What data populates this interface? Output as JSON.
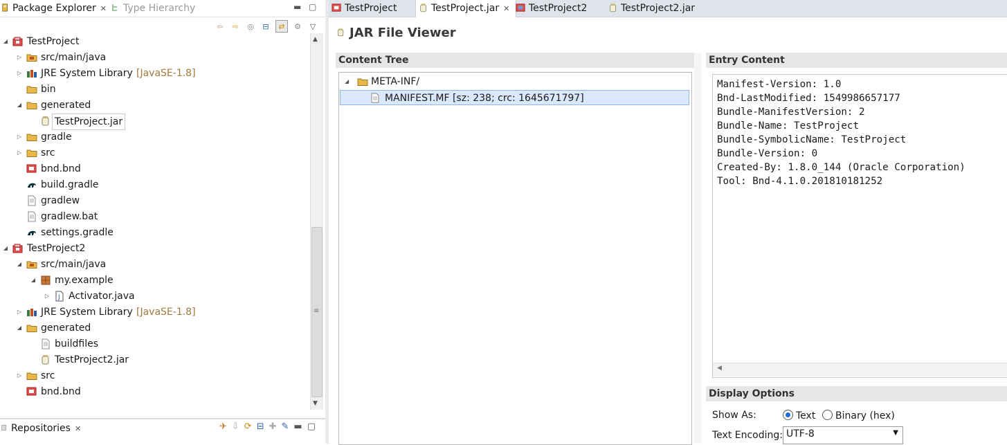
{
  "explorer": {
    "tab_label": "Package Explorer",
    "tab2_label": "Type Hierarchy",
    "tree": [
      {
        "label": "TestProject",
        "deco": "",
        "indent": 0,
        "twisty": "▲",
        "icon": "project-icon"
      },
      {
        "label": "src/main/java",
        "deco": "",
        "indent": 1,
        "twisty": "▷",
        "icon": "source-folder-icon"
      },
      {
        "label": "JRE System Library",
        "deco": "[JavaSE-1.8]",
        "indent": 1,
        "twisty": "▷",
        "icon": "library-icon"
      },
      {
        "label": "bin",
        "deco": "",
        "indent": 1,
        "twisty": "",
        "icon": "folder-icon"
      },
      {
        "label": "generated",
        "deco": "",
        "indent": 1,
        "twisty": "▲",
        "icon": "folder-icon"
      },
      {
        "label": "TestProject.jar",
        "deco": "",
        "indent": 2,
        "twisty": "",
        "icon": "jar-icon",
        "selected": true
      },
      {
        "label": "gradle",
        "deco": "",
        "indent": 1,
        "twisty": "▷",
        "icon": "folder-icon"
      },
      {
        "label": "src",
        "deco": "",
        "indent": 1,
        "twisty": "▷",
        "icon": "folder-icon"
      },
      {
        "label": "bnd.bnd",
        "deco": "",
        "indent": 1,
        "twisty": "",
        "icon": "bnd-file-icon"
      },
      {
        "label": "build.gradle",
        "deco": "",
        "indent": 1,
        "twisty": "",
        "icon": "gradle-icon"
      },
      {
        "label": "gradlew",
        "deco": "",
        "indent": 1,
        "twisty": "",
        "icon": "file-icon"
      },
      {
        "label": "gradlew.bat",
        "deco": "",
        "indent": 1,
        "twisty": "",
        "icon": "file-icon"
      },
      {
        "label": "settings.gradle",
        "deco": "",
        "indent": 1,
        "twisty": "",
        "icon": "gradle-icon"
      },
      {
        "label": "TestProject2",
        "deco": "",
        "indent": 0,
        "twisty": "▲",
        "icon": "project-icon"
      },
      {
        "label": "src/main/java",
        "deco": "",
        "indent": 1,
        "twisty": "▲",
        "icon": "source-folder-icon"
      },
      {
        "label": "my.example",
        "deco": "",
        "indent": 2,
        "twisty": "▲",
        "icon": "package-icon"
      },
      {
        "label": "Activator.java",
        "deco": "",
        "indent": 3,
        "twisty": "▷",
        "icon": "java-file-icon"
      },
      {
        "label": "JRE System Library",
        "deco": "[JavaSE-1.8]",
        "indent": 1,
        "twisty": "▷",
        "icon": "library-icon"
      },
      {
        "label": "generated",
        "deco": "",
        "indent": 1,
        "twisty": "▲",
        "icon": "folder-icon"
      },
      {
        "label": "buildfiles",
        "deco": "",
        "indent": 2,
        "twisty": "",
        "icon": "file-icon"
      },
      {
        "label": "TestProject2.jar",
        "deco": "",
        "indent": 2,
        "twisty": "",
        "icon": "jar-icon"
      },
      {
        "label": "src",
        "deco": "",
        "indent": 1,
        "twisty": "▷",
        "icon": "folder-icon"
      },
      {
        "label": "bnd.bnd",
        "deco": "",
        "indent": 1,
        "twisty": "",
        "icon": "bnd-file-icon"
      }
    ]
  },
  "repositories": {
    "tab_label": "Repositories"
  },
  "editor": {
    "tabs": [
      {
        "label": "TestProject",
        "icon": "bnd-file-icon"
      },
      {
        "label": "TestProject.jar",
        "icon": "jar-icon",
        "active": true
      },
      {
        "label": "TestProject2",
        "icon": "bnd-file-icon"
      },
      {
        "label": "TestProject2.jar",
        "icon": "jar-icon"
      }
    ],
    "viewer_title": "JAR File Viewer",
    "content_tree_header": "Content Tree",
    "content_tree": [
      {
        "label": "META-INF/"
      },
      {
        "label": "MANIFEST.MF [sz: 238; crc: 1645671797]"
      }
    ],
    "entry_content_header": "Entry Content",
    "entry_lines": [
      "Manifest-Version: 1.0",
      "Bnd-LastModified: 1549986657177",
      "Bundle-ManifestVersion: 2",
      "Bundle-Name: TestProject",
      "Bundle-SymbolicName: TestProject",
      "Bundle-Version: 0",
      "Created-By: 1.8.0_144 (Oracle Corporation)",
      "Tool: Bnd-4.1.0.201810181252"
    ],
    "display_options_header": "Display Options",
    "show_as_label": "Show As:",
    "option_text": "Text",
    "option_binary": "Binary (hex)",
    "show_as_selected": "Text",
    "text_encoding_label": "Text Encoding:",
    "text_encoding_value": "UTF-8"
  },
  "colors": {
    "selection_bg": "#cce8ff",
    "decoration": "#a07a3b",
    "folder": "#e8b84a"
  }
}
